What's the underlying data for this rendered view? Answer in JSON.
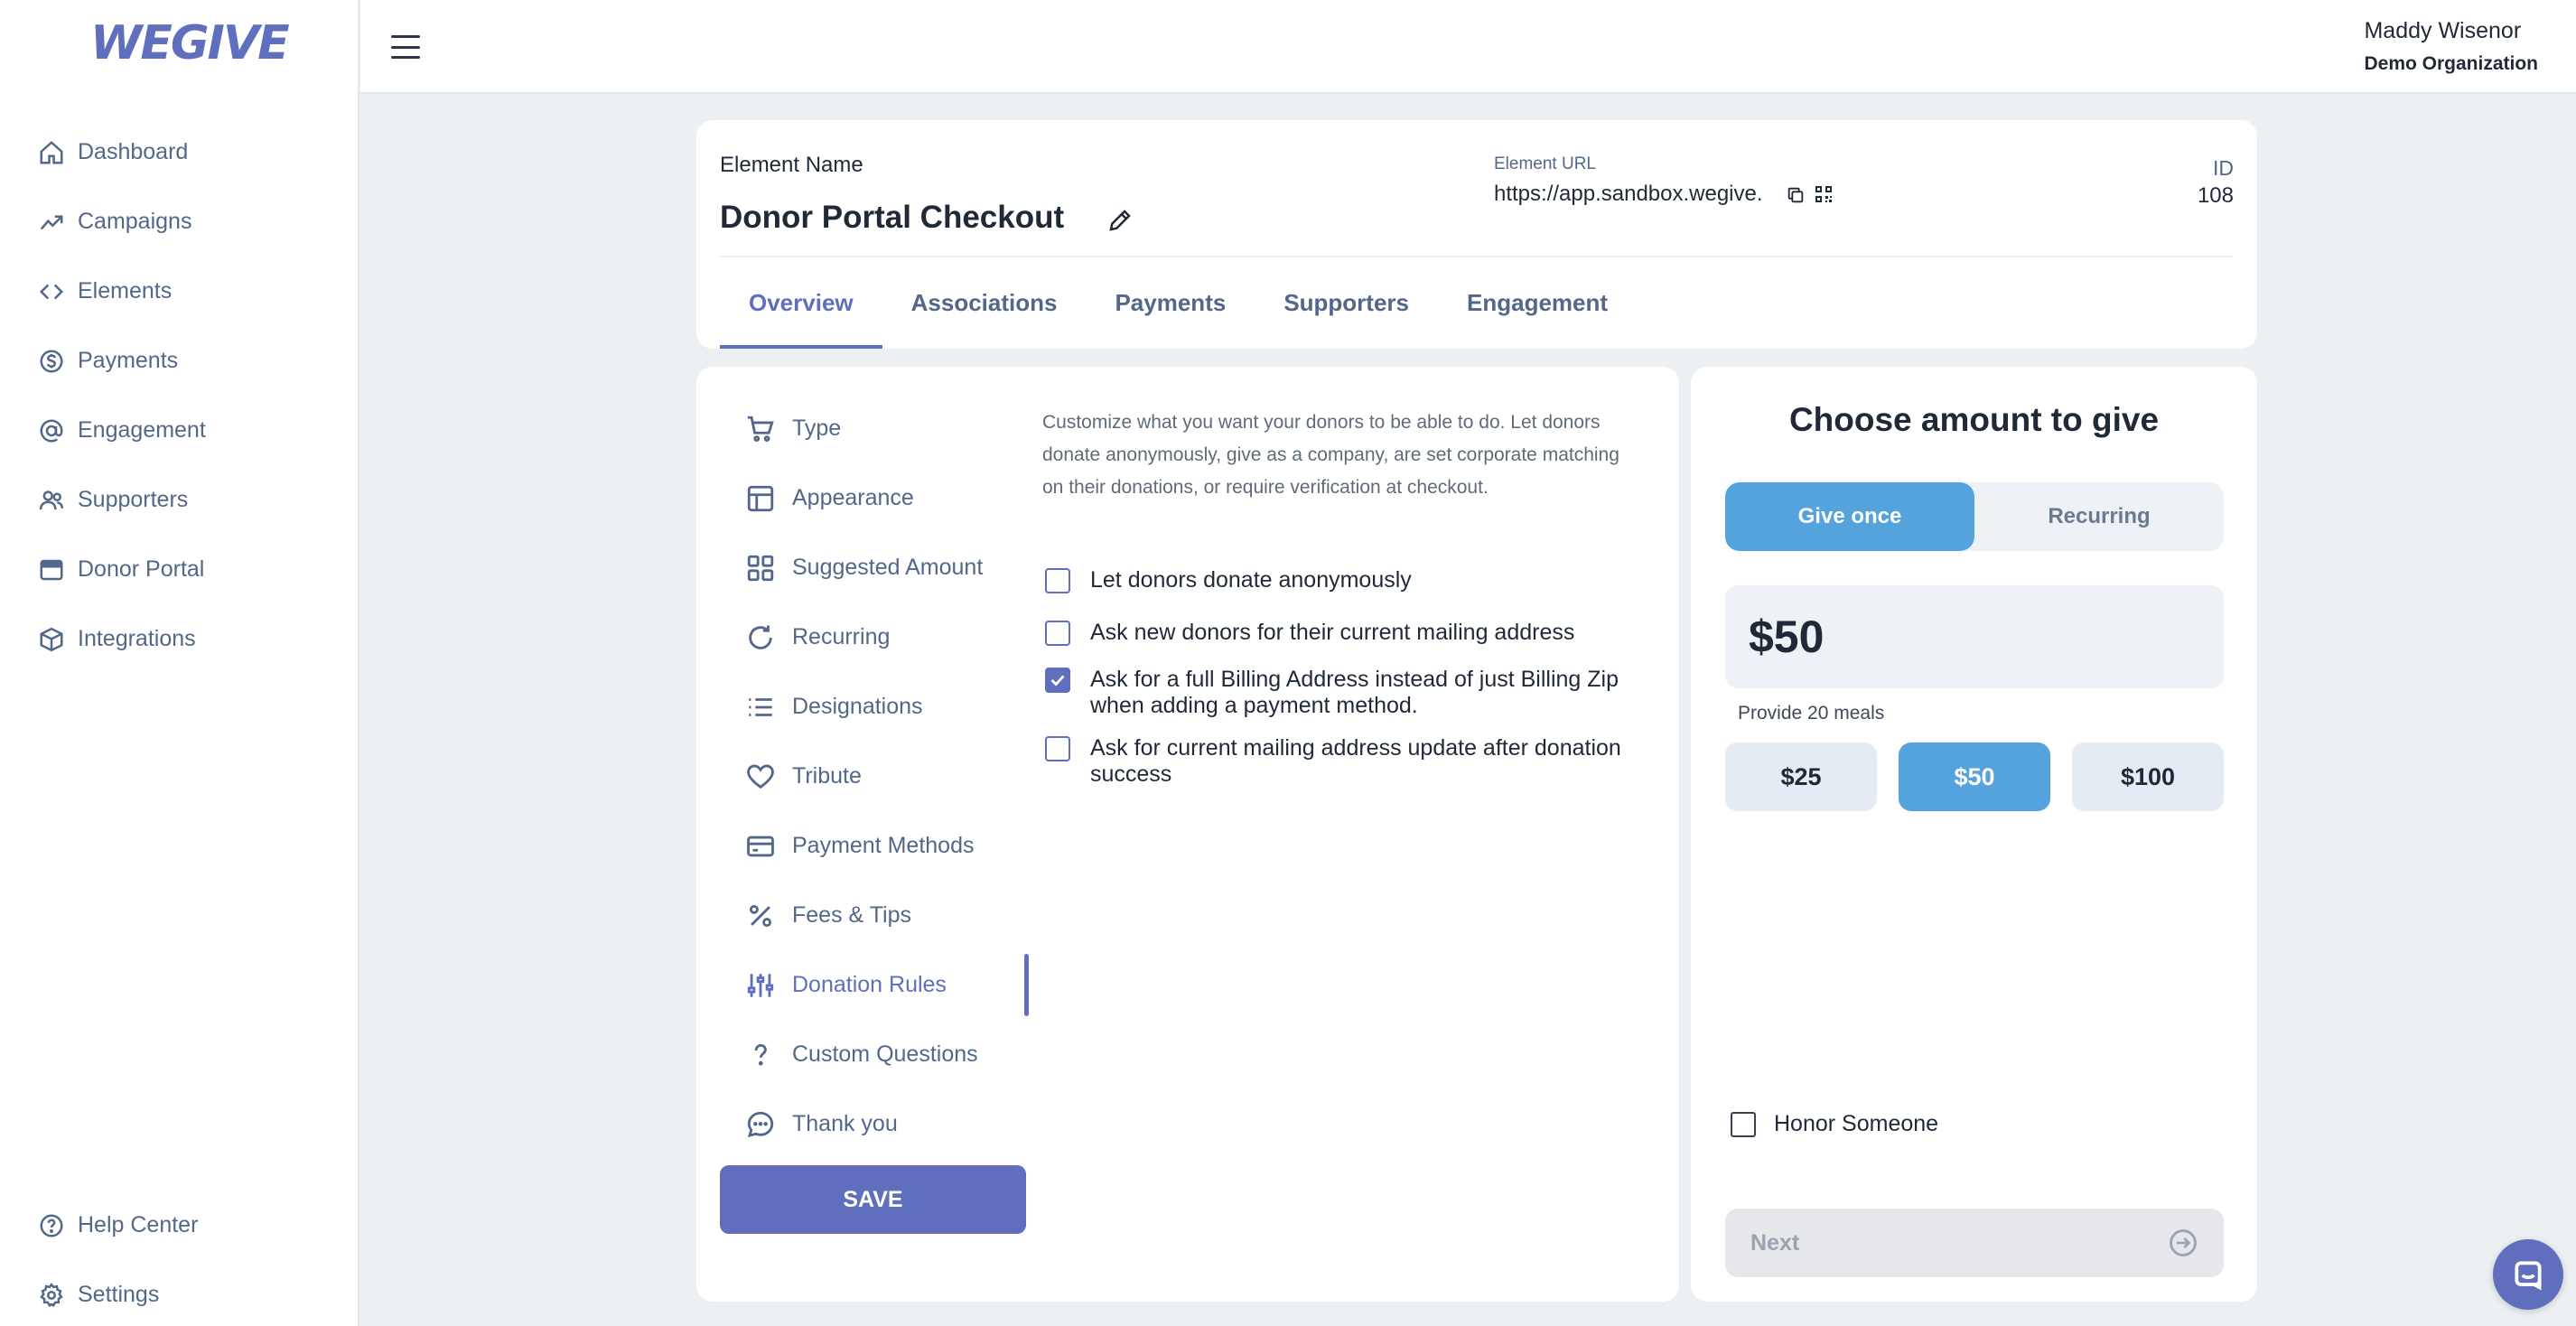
{
  "brand": {
    "logo": "WEGIVE",
    "accent": "#5f6fbd",
    "preview_accent": "#54a3dc"
  },
  "sidebar": {
    "items": [
      {
        "label": "Dashboard",
        "icon": "home-icon"
      },
      {
        "label": "Campaigns",
        "icon": "trending-up-icon"
      },
      {
        "label": "Elements",
        "icon": "code-icon"
      },
      {
        "label": "Payments",
        "icon": "dollar-circle-icon"
      },
      {
        "label": "Engagement",
        "icon": "at-sign-icon"
      },
      {
        "label": "Supporters",
        "icon": "users-icon"
      },
      {
        "label": "Donor Portal",
        "icon": "browser-window-icon"
      },
      {
        "label": "Integrations",
        "icon": "cube-icon"
      }
    ],
    "bottom_items": [
      {
        "label": "Help Center",
        "icon": "help-circle-icon"
      },
      {
        "label": "Settings",
        "icon": "gear-icon"
      }
    ]
  },
  "topbar": {
    "user_name": "Maddy Wisenor",
    "org_name": "Demo Organization"
  },
  "element": {
    "name_label": "Element Name",
    "name": "Donor Portal Checkout",
    "url_label": "Element URL",
    "url": "https://app.sandbox.wegive.",
    "id_label": "ID",
    "id": "108"
  },
  "tabs": [
    {
      "label": "Overview",
      "active": true
    },
    {
      "label": "Associations",
      "active": false
    },
    {
      "label": "Payments",
      "active": false
    },
    {
      "label": "Supporters",
      "active": false
    },
    {
      "label": "Engagement",
      "active": false
    }
  ],
  "settings_menu": [
    {
      "label": "Type",
      "icon": "cart-icon"
    },
    {
      "label": "Appearance",
      "icon": "layout-icon"
    },
    {
      "label": "Suggested Amount",
      "icon": "grid-icon"
    },
    {
      "label": "Recurring",
      "icon": "refresh-icon"
    },
    {
      "label": "Designations",
      "icon": "list-icon"
    },
    {
      "label": "Tribute",
      "icon": "heart-icon"
    },
    {
      "label": "Payment Methods",
      "icon": "credit-card-icon"
    },
    {
      "label": "Fees & Tips",
      "icon": "percent-icon"
    },
    {
      "label": "Donation Rules",
      "icon": "sliders-icon",
      "active": true
    },
    {
      "label": "Custom Questions",
      "icon": "question-mark-icon"
    },
    {
      "label": "Thank you",
      "icon": "chat-bubble-icon"
    }
  ],
  "save_label": "SAVE",
  "donation_rules": {
    "description": "Customize what you want your donors to be able to do. Let donors donate anonymously, give as a company, are set corporate matching on their donations, or require verification at checkout.",
    "options": [
      {
        "label": "Let donors donate anonymously",
        "checked": false
      },
      {
        "label": "Ask new donors for their current mailing address",
        "checked": false
      },
      {
        "label": "Ask for a full Billing Address instead of just Billing Zip when adding a payment method.",
        "checked": true
      },
      {
        "label": "Ask for current mailing address update after donation success",
        "checked": false
      }
    ]
  },
  "preview": {
    "title": "Choose amount to give",
    "frequency": [
      {
        "label": "Give once",
        "active": true
      },
      {
        "label": "Recurring",
        "active": false
      }
    ],
    "amount": "$50",
    "impact": "Provide 20 meals",
    "amounts": [
      {
        "label": "$25",
        "active": false
      },
      {
        "label": "$50",
        "active": true
      },
      {
        "label": "$100",
        "active": false
      }
    ],
    "honor_label": "Honor Someone",
    "next_label": "Next"
  }
}
